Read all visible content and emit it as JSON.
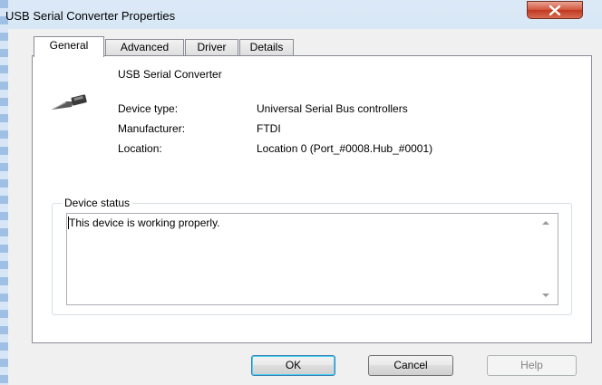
{
  "window": {
    "title": "USB Serial Converter Properties",
    "close_icon": "close-icon",
    "accent_color": "#c0391f"
  },
  "tabs": [
    {
      "label": "General",
      "active": true
    },
    {
      "label": "Advanced",
      "active": false
    },
    {
      "label": "Driver",
      "active": false
    },
    {
      "label": "Details",
      "active": false
    }
  ],
  "general": {
    "device_icon": "usb-cable-icon",
    "device_name": "USB Serial Converter",
    "properties": [
      {
        "label": "Device type:",
        "value": "Universal Serial Bus controllers"
      },
      {
        "label": "Manufacturer:",
        "value": "FTDI"
      },
      {
        "label": "Location:",
        "value": "Location 0 (Port_#0008.Hub_#0001)"
      }
    ],
    "status_group_title": "Device status",
    "status_text": "This device is working properly."
  },
  "buttons": {
    "ok": "OK",
    "cancel": "Cancel",
    "help": "Help"
  }
}
